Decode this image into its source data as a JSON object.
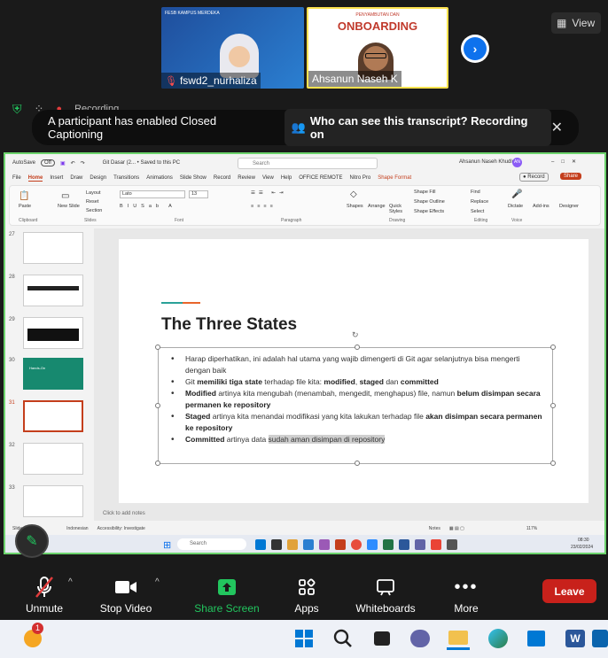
{
  "gallery": {
    "participants": [
      {
        "name": "fswd2_nurhaliza",
        "muted": true
      },
      {
        "name": "Ahsanun Naseh K",
        "muted": false
      }
    ],
    "tile1_banner": "FESB KAMPUS MERDEKA",
    "tile2_banner_top": "PENYAMBUTAN DAN",
    "tile2_banner_main": "ONBOARDING",
    "view_label": "View"
  },
  "recording": {
    "label": "Recording"
  },
  "caption_bar": {
    "message": "A participant has enabled Closed Captioning",
    "who_label": "Who can see this transcript? Recording on",
    "close": "✕"
  },
  "ppt": {
    "autosave": "AutoSave",
    "autosave_state": "Off",
    "doc_title": "Git Dasar (2... • Saved to this PC",
    "search_placeholder": "Search",
    "user": "Ahsanun Naseh Khudlori",
    "user_initials": "AN",
    "menu": [
      "File",
      "Home",
      "Insert",
      "Draw",
      "Design",
      "Transitions",
      "Animations",
      "Slide Show",
      "Record",
      "Review",
      "View",
      "Help",
      "OFFICE REMOTE",
      "Nitro Pro",
      "Shape Format"
    ],
    "active_menu": "Home",
    "record_btn": "Record",
    "share_btn": "Share",
    "ribbon": {
      "clipboard": "Clipboard",
      "paste": "Paste",
      "slides": "Slides",
      "new_slide": "New Slide",
      "layout": "Layout",
      "reset": "Reset",
      "section": "Section",
      "font": "Font",
      "font_name": "Lato",
      "font_size": "13",
      "paragraph": "Paragraph",
      "drawing": "Drawing",
      "shapes": "Shapes",
      "arrange": "Arrange",
      "quick_styles": "Quick Styles",
      "shape_fill": "Shape Fill",
      "shape_outline": "Shape Outline",
      "shape_effects": "Shape Effects",
      "editing": "Editing",
      "find": "Find",
      "replace": "Replace",
      "select": "Select",
      "voice": "Voice",
      "dictate": "Dictate",
      "addins": "Add-ins",
      "designer": "Designer"
    },
    "thumb_numbers": [
      "27",
      "28",
      "29",
      "30",
      "31",
      "32",
      "33"
    ],
    "thumb_30_label": "Hands-On",
    "selected_thumb": "31",
    "slide": {
      "title": "The Three States",
      "b1": "Harap diperhatikan, ini adalah hal utama yang wajib dimengerti di Git agar selanjutnya bisa mengerti dengan baik",
      "b2_pre": "Git ",
      "b2_bold": "memiliki tiga state",
      "b2_mid": " terhadap file kita: ",
      "b2_s1": "modified",
      "b2_comma": ", ",
      "b2_s2": "staged",
      "b2_and": " dan ",
      "b2_s3": "committed",
      "b3_bold": "Modified",
      "b3_text": " artinya kita mengubah (menambah, mengedit, menghapus) file, namun ",
      "b3_bold2": "belum disimpan secara permanen ke repository",
      "b4_bold": "Staged",
      "b4_text": " artinya kita menandai modifikasi yang kita lakukan terhadap file ",
      "b4_bold2": "akan disimpan secara permanen ke repository",
      "b5_bold": "Committed",
      "b5_text": " artinya data ",
      "b5_hl": "sudah aman disimpan di repository"
    },
    "notes_placeholder": "Click to add notes",
    "status": {
      "slide_of": "Slide",
      "language": "Indonesian",
      "accessibility": "Accessibility: Investigate",
      "notes": "Notes",
      "zoom": "117%"
    },
    "taskbar_search": "Search",
    "clock_time": "08:30",
    "clock_date": "23/02/2024"
  },
  "zoom_bar": {
    "unmute": "Unmute",
    "stop_video": "Stop Video",
    "share_screen": "Share Screen",
    "apps": "Apps",
    "whiteboards": "Whiteboards",
    "more": "More",
    "leave": "Leave"
  },
  "os_taskbar": {
    "notification_badge": "1"
  },
  "colors": {
    "share_green": "#22c55e",
    "leave_red": "#c8211b",
    "zoom_blue": "#0e72ed",
    "active_border": "#6cd36c"
  }
}
